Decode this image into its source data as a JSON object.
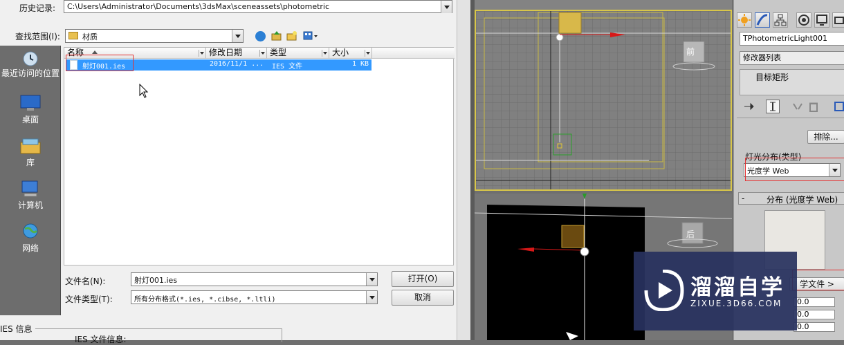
{
  "dialog": {
    "history_label": "历史记录:",
    "history_path": "C:\\Users\\Administrator\\Documents\\3dsMax\\sceneassets\\photometric",
    "lookin_label": "查找范围(I):",
    "lookin_value": "材质",
    "places": [
      "最近访问的位置",
      "桌面",
      "库",
      "计算机",
      "网络"
    ],
    "columns": [
      "名称",
      "修改日期",
      "类型",
      "大小"
    ],
    "files": [
      {
        "name": "射灯001.ies",
        "date": "2016/11/1 ...",
        "type": "IES 文件",
        "size": "1 KB"
      }
    ],
    "filename_label": "文件名(N):",
    "filename_value": "射灯001.ies",
    "filetype_label": "文件类型(T):",
    "filetype_value": "所有分布格式(*.ies, *.cibse, *.ltli)",
    "open_label": "打开(O)",
    "cancel_label": "取消",
    "ies_info_label": "IES 信息",
    "ies_file_info_label": "IES 文件信息:"
  },
  "viewport": {
    "top_label": "前",
    "persp_label": "后"
  },
  "command_panel": {
    "object_name": "TPhotometricLight001",
    "modifier_list_label": "修改器列表",
    "stack_item": "目标矩形",
    "exclude_label": "排除...",
    "distribution_group_label": "灯光分布(类型)",
    "distribution_value": "光度学 Web",
    "rollout_minus": "-",
    "rollout_title": "分布 (光度学 Web)",
    "choose_file_label": "学文件 >",
    "spinners": [
      "0.0",
      "0.0",
      "0.0"
    ]
  },
  "watermark": {
    "brand": "溜溜自学",
    "url": "ZIXUE.3D66.COM"
  },
  "colors": {
    "selection": "#3399ff",
    "highlight_red": "#e53030",
    "viewport_active": "#d8c64a",
    "watermark_bg": "#28325f"
  }
}
